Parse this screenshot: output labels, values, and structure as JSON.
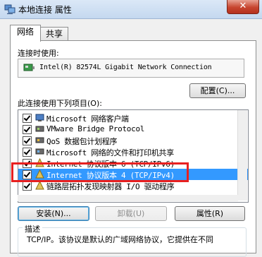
{
  "window": {
    "title": "本地连接 属性",
    "close_symbol": "✕"
  },
  "tabs": [
    {
      "label": "网络",
      "active": true
    },
    {
      "label": "共享",
      "active": false
    }
  ],
  "connect_using_label": "连接时使用:",
  "adapter_name": "Intel(R) 82574L Gigabit Network Connection",
  "configure_button": "配置(C)...",
  "items_label": "此连接使用下列项目(O):",
  "items": [
    {
      "label": "Microsoft 网络客户端",
      "checked": true,
      "icon": "network-client-icon"
    },
    {
      "label": "VMware Bridge Protocol",
      "checked": true,
      "icon": "network-protocol-icon"
    },
    {
      "label": "QoS 数据包计划程序",
      "checked": true,
      "icon": "qos-icon"
    },
    {
      "label": "Microsoft 网络的文件和打印机共享",
      "checked": true,
      "icon": "file-sharing-icon"
    },
    {
      "label": "Internet 协议版本 6 (TCP/IPv6)",
      "checked": true,
      "icon": "protocol-icon"
    },
    {
      "label": "Internet 协议版本 4 (TCP/IPv4)",
      "checked": true,
      "icon": "protocol-icon",
      "selected": true
    },
    {
      "label": "链路层拓扑发现映射器 I/O 驱动程序",
      "checked": true,
      "icon": "protocol-icon"
    }
  ],
  "buttons": {
    "install": "安装(N)...",
    "uninstall": "卸载(U)",
    "properties": "属性(R)"
  },
  "description": {
    "legend": "描述",
    "text": "TCP/IP。该协议是默认的广域网络协议，它提供在不同"
  },
  "colors": {
    "highlight": "#3399ff",
    "annotation_red": "#e82020"
  }
}
